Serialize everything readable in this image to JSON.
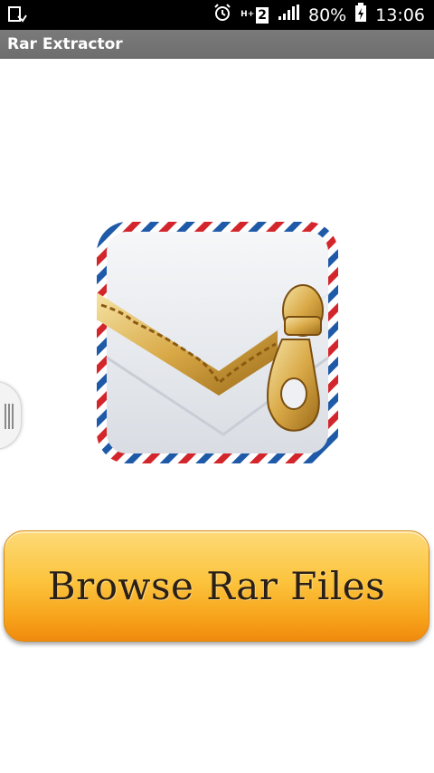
{
  "status_bar": {
    "battery_percent": "80%",
    "time": "13:06",
    "network_type": "H+",
    "sim_slot": "2",
    "icons": [
      "download-notification-icon",
      "alarm-icon",
      "network-type-icon",
      "signal-icon",
      "battery-icon"
    ]
  },
  "app_bar": {
    "title": "Rar Extractor"
  },
  "main": {
    "browse_label": "Browse Rar Files",
    "logo_icon": "zipped-envelope-logo"
  },
  "colors": {
    "status_bar": "#000000",
    "app_bar": "#737373",
    "button_top": "#fdda78",
    "button_bottom": "#f08a0e",
    "button_text": "#2a2017"
  }
}
